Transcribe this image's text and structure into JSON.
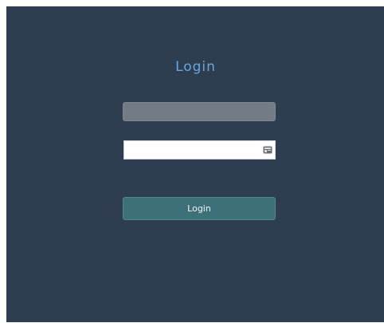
{
  "login": {
    "title": "Login",
    "username": {
      "value": "",
      "placeholder": ""
    },
    "password": {
      "value": "",
      "placeholder": ""
    },
    "password_icon": "key-icon",
    "button_label": "Login"
  },
  "colors": {
    "background": "#2e3d50",
    "title": "#6aa6e0",
    "username_field": "#737c86",
    "button": "#3d7078"
  }
}
